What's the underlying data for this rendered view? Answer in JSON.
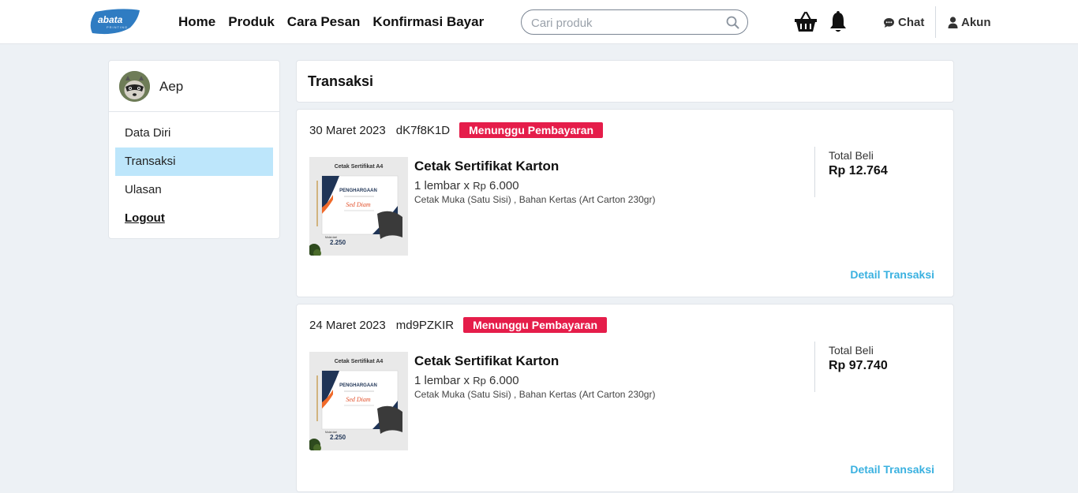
{
  "header": {
    "logo_text": "abata",
    "logo_sub": "PRINTING",
    "nav": [
      {
        "label": "Home"
      },
      {
        "label": "Produk"
      },
      {
        "label": "Cara Pesan"
      },
      {
        "label": "Konfirmasi Bayar"
      }
    ],
    "search_placeholder": "Cari produk",
    "chat_label": "Chat",
    "akun_label": "Akun"
  },
  "sidebar": {
    "username": "Aep",
    "menu": [
      {
        "label": "Data Diri",
        "active": false
      },
      {
        "label": "Transaksi",
        "active": true
      },
      {
        "label": "Ulasan",
        "active": false
      },
      {
        "label": "Logout",
        "active": false
      }
    ]
  },
  "main": {
    "title": "Transaksi",
    "transactions": [
      {
        "date": "30 Maret 2023",
        "code": "dK7f8K1D",
        "status": "Menunggu Pembayaran",
        "product_name": "Cetak Sertifikat Karton",
        "qty": "1 lembar x",
        "price_currency": "Rp",
        "price": "6.000",
        "spec": "Cetak Muka (Satu Sisi) , Bahan Kertas (Art Carton 230gr)",
        "total_label": "Total Beli",
        "total": "Rp 12.764",
        "detail_label": "Detail Transaksi",
        "thumb": {
          "title": "Cetak Sertifikat A4",
          "heading": "PENGHARGAAN",
          "name": "Sed Diam",
          "price_prefix": "Mulai dari",
          "price": "2.250"
        }
      },
      {
        "date": "24 Maret 2023",
        "code": "md9PZKIR",
        "status": "Menunggu Pembayaran",
        "product_name": "Cetak Sertifikat Karton",
        "qty": "1 lembar x",
        "price_currency": "Rp",
        "price": "6.000",
        "spec": "Cetak Muka (Satu Sisi) , Bahan Kertas (Art Carton 230gr)",
        "total_label": "Total Beli",
        "total": "Rp 97.740",
        "detail_label": "Detail Transaksi",
        "thumb": {
          "title": "Cetak Sertifikat A4",
          "heading": "PENGHARGAAN",
          "name": "Sed Diam",
          "price_prefix": "Mulai dari",
          "price": "2.250"
        }
      }
    ]
  },
  "colors": {
    "accent": "#3ab1e0",
    "badge": "#e51d4a",
    "active_menu": "#bde6fb",
    "logo_blue": "#2f7cc2"
  }
}
